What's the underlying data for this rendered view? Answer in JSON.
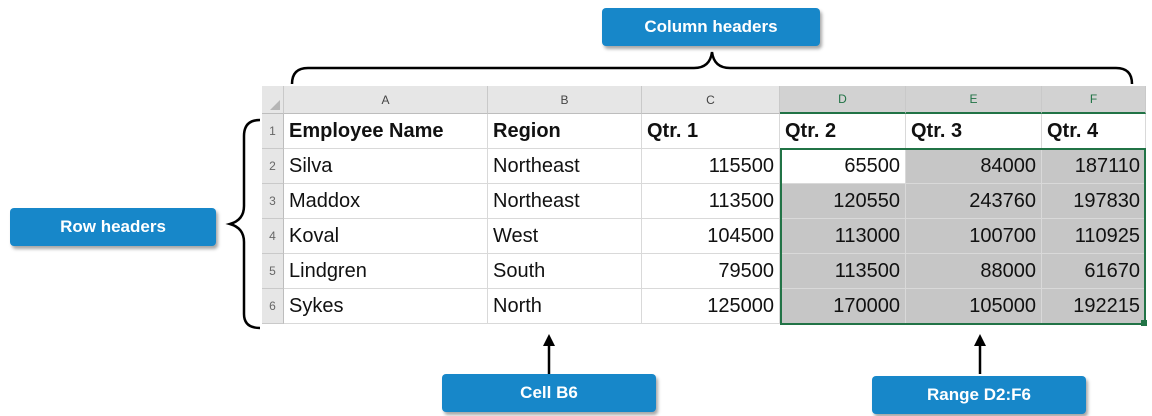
{
  "callouts": {
    "column_headers": "Column headers",
    "row_headers": "Row headers",
    "cell_b6": "Cell B6",
    "range_d2_f6": "Range D2:F6"
  },
  "columns": [
    "A",
    "B",
    "C",
    "D",
    "E",
    "F"
  ],
  "rows": [
    "1",
    "2",
    "3",
    "4",
    "5",
    "6"
  ],
  "table": {
    "headers": [
      "Employee Name",
      "Region",
      "Qtr. 1",
      "Qtr. 2",
      "Qtr. 3",
      "Qtr. 4"
    ],
    "rows": [
      [
        "Silva",
        "Northeast",
        "115500",
        "65500",
        "84000",
        "187110"
      ],
      [
        "Maddox",
        "Northeast",
        "113500",
        "120550",
        "243760",
        "197830"
      ],
      [
        "Koval",
        "West",
        "104500",
        "113000",
        "100700",
        "110925"
      ],
      [
        "Lindgren",
        "South",
        "79500",
        "113500",
        "88000",
        "61670"
      ],
      [
        "Sykes",
        "North",
        "125000",
        "170000",
        "105000",
        "192215"
      ]
    ]
  },
  "colors": {
    "callout_bg": "#1787c9",
    "range_fill": "#c6c6c6",
    "selection_border": "#217346"
  }
}
